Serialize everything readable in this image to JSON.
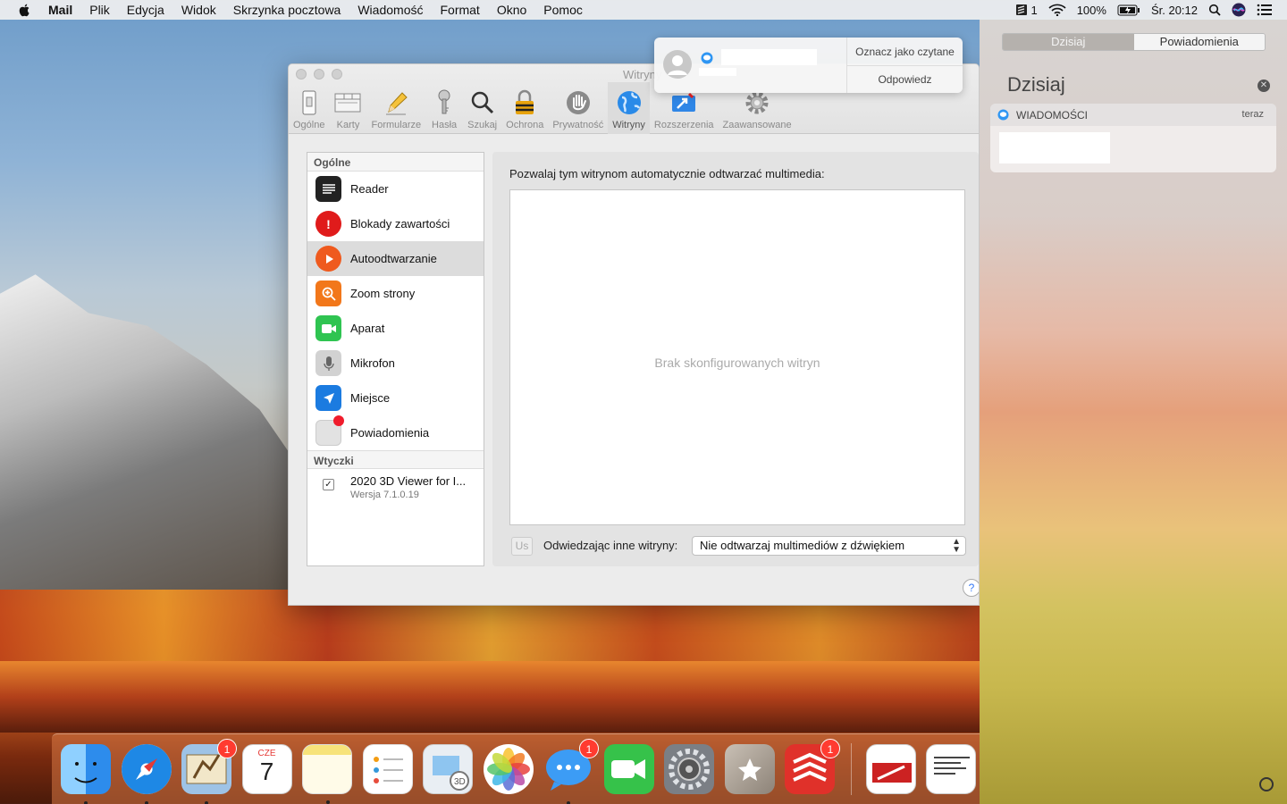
{
  "menubar": {
    "app_name": "Mail",
    "items": [
      "Plik",
      "Edycja",
      "Widok",
      "Skrzynka pocztowa",
      "Wiadomość",
      "Format",
      "Okno",
      "Pomoc"
    ],
    "status_count": "1",
    "battery": "100%",
    "clock": "Śr. 20:12"
  },
  "window": {
    "title": "Witryny",
    "toolbar": [
      {
        "label": "Ogólne",
        "icon": "switch-icon"
      },
      {
        "label": "Karty",
        "icon": "tabs-icon"
      },
      {
        "label": "Formularze",
        "icon": "pencil-icon"
      },
      {
        "label": "Hasła",
        "icon": "key-icon"
      },
      {
        "label": "Szukaj",
        "icon": "magnifier-icon"
      },
      {
        "label": "Ochrona",
        "icon": "lock-icon"
      },
      {
        "label": "Prywatność",
        "icon": "hand-icon"
      },
      {
        "label": "Witryny",
        "icon": "globe-icon",
        "selected": true
      },
      {
        "label": "Rozszerzenia",
        "icon": "puzzle-icon"
      },
      {
        "label": "Zaawansowane",
        "icon": "gear-icon"
      }
    ],
    "sidebar": {
      "section_general": "Ogólne",
      "items": [
        {
          "label": "Reader",
          "icon": "reader-icon",
          "color": "#222222"
        },
        {
          "label": "Blokady zawartości",
          "icon": "alert-icon",
          "color": "#e01b1b"
        },
        {
          "label": "Autoodtwarzanie",
          "icon": "play-icon",
          "color": "#ef5a1e",
          "selected": true
        },
        {
          "label": "Zoom strony",
          "icon": "zoom-icon",
          "color": "#f2771a"
        },
        {
          "label": "Aparat",
          "icon": "camera-icon",
          "color": "#2fc451"
        },
        {
          "label": "Mikrofon",
          "icon": "microphone-icon",
          "color": "#c9c9c9"
        },
        {
          "label": "Miejsce",
          "icon": "location-icon",
          "color": "#1b7be0"
        },
        {
          "label": "Powiadomienia",
          "icon": "notifications-icon",
          "color": "#d8d8d8"
        }
      ],
      "section_plugins": "Wtyczki",
      "plugin": {
        "name": "2020 3D Viewer for I...",
        "version": "Wersja 7.1.0.19",
        "checked": true
      }
    },
    "pane": {
      "heading": "Pozwalaj tym witrynom automatycznie odtwarzać multimedia:",
      "empty_text": "Brak skonfigurowanych witryn",
      "remove_button": "Us",
      "other_label": "Odwiedzając inne witryny:",
      "select_value": "Nie odtwarzaj multimediów z dźwiękiem"
    },
    "help": "?"
  },
  "banner": {
    "mark_read": "Oznacz jako czytane",
    "reply": "Odpowiedz"
  },
  "notification_center": {
    "tab_today": "Dzisiaj",
    "tab_notifications": "Powiadomienia",
    "heading": "Dzisiaj",
    "card_app": "WIADOMOŚCI",
    "card_time": "teraz"
  },
  "dock": {
    "apps": [
      {
        "name": "finder-icon",
        "color": "#3aa0f0",
        "badge": ""
      },
      {
        "name": "safari-icon",
        "color": "#1e88e5",
        "badge": ""
      },
      {
        "name": "mail-icon",
        "color": "#9ec3e6",
        "badge": "1"
      },
      {
        "name": "calendar-icon",
        "color": "#ffffff",
        "badge": "",
        "text": "7",
        "month": "CZE"
      },
      {
        "name": "notes-icon",
        "color": "#f7e37a",
        "badge": ""
      },
      {
        "name": "reminders-icon",
        "color": "#ffffff",
        "badge": ""
      },
      {
        "name": "preview-icon",
        "color": "#e9eef3",
        "badge": ""
      },
      {
        "name": "photos-icon",
        "color": "#ffffff",
        "badge": ""
      },
      {
        "name": "messages-icon",
        "color": "#3c9cf5",
        "badge": "1"
      },
      {
        "name": "facetime-icon",
        "color": "#36c24a",
        "badge": ""
      },
      {
        "name": "system-preferences-icon",
        "color": "#7b7f85",
        "badge": ""
      },
      {
        "name": "package-icon",
        "color": "#a89f95",
        "badge": ""
      },
      {
        "name": "todoist-icon",
        "color": "#e0312a",
        "badge": "1"
      },
      {
        "name": "document-icon",
        "color": "#ffffff",
        "badge": ""
      },
      {
        "name": "screenshot-icon",
        "color": "#ffffff",
        "badge": ""
      }
    ]
  }
}
